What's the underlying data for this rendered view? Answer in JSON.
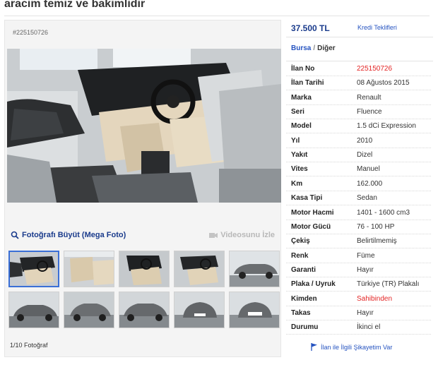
{
  "title": "aracim temiz ve bakimlidir",
  "ad_number_label": "#225150726",
  "photos": {
    "mega_link": "Fotoğrafı Büyüt (Mega Foto)",
    "video_link": "Videosunu İzle",
    "count": "1/10 Fotoğraf",
    "thumbnails": [
      {
        "kind": "interior"
      },
      {
        "kind": "interior-rear"
      },
      {
        "kind": "interior"
      },
      {
        "kind": "interior"
      },
      {
        "kind": "exterior-side"
      },
      {
        "kind": "exterior-front"
      },
      {
        "kind": "exterior-front"
      },
      {
        "kind": "exterior-front"
      },
      {
        "kind": "exterior-front"
      },
      {
        "kind": "exterior-rear"
      }
    ]
  },
  "price": "37.500 TL",
  "credit_link": "Kredi Teklifleri",
  "location": {
    "city": "Bursa",
    "separator": "/",
    "district": "Diğer"
  },
  "details": [
    {
      "label": "İlan No",
      "value": "225150726",
      "highlight": true
    },
    {
      "label": "İlan Tarihi",
      "value": "08 Ağustos 2015"
    },
    {
      "label": "Marka",
      "value": "Renault"
    },
    {
      "label": "Seri",
      "value": "Fluence"
    },
    {
      "label": "Model",
      "value": "1.5 dCi Expression"
    },
    {
      "label": "Yıl",
      "value": "2010"
    },
    {
      "label": "Yakıt",
      "value": "Dizel"
    },
    {
      "label": "Vites",
      "value": "Manuel"
    },
    {
      "label": "Km",
      "value": "162.000"
    },
    {
      "label": "Kasa Tipi",
      "value": "Sedan"
    },
    {
      "label": "Motor Hacmi",
      "value": "1401 - 1600 cm3"
    },
    {
      "label": "Motor Gücü",
      "value": "76 - 100 HP"
    },
    {
      "label": "Çekiş",
      "value": "Belirtilmemiş"
    },
    {
      "label": "Renk",
      "value": "Füme"
    },
    {
      "label": "Garanti",
      "value": "Hayır"
    },
    {
      "label": "Plaka / Uyruk",
      "value": "Türkiye (TR) Plakalı"
    },
    {
      "label": "Kimden",
      "value": "Sahibinden",
      "highlight": true
    },
    {
      "label": "Takas",
      "value": "Hayır"
    },
    {
      "label": "Durumu",
      "value": "İkinci el"
    }
  ],
  "complaint_link": "İlan ile İlgili Şikayetim Var",
  "colors": {
    "link": "#2553c0",
    "price": "#1a3b8c",
    "highlight": "#e32424",
    "panel_bg": "#f4f4f4"
  },
  "icons": {
    "mega_photo": "magnifier-icon",
    "video": "video-camera-icon",
    "complaint": "flag-icon"
  }
}
